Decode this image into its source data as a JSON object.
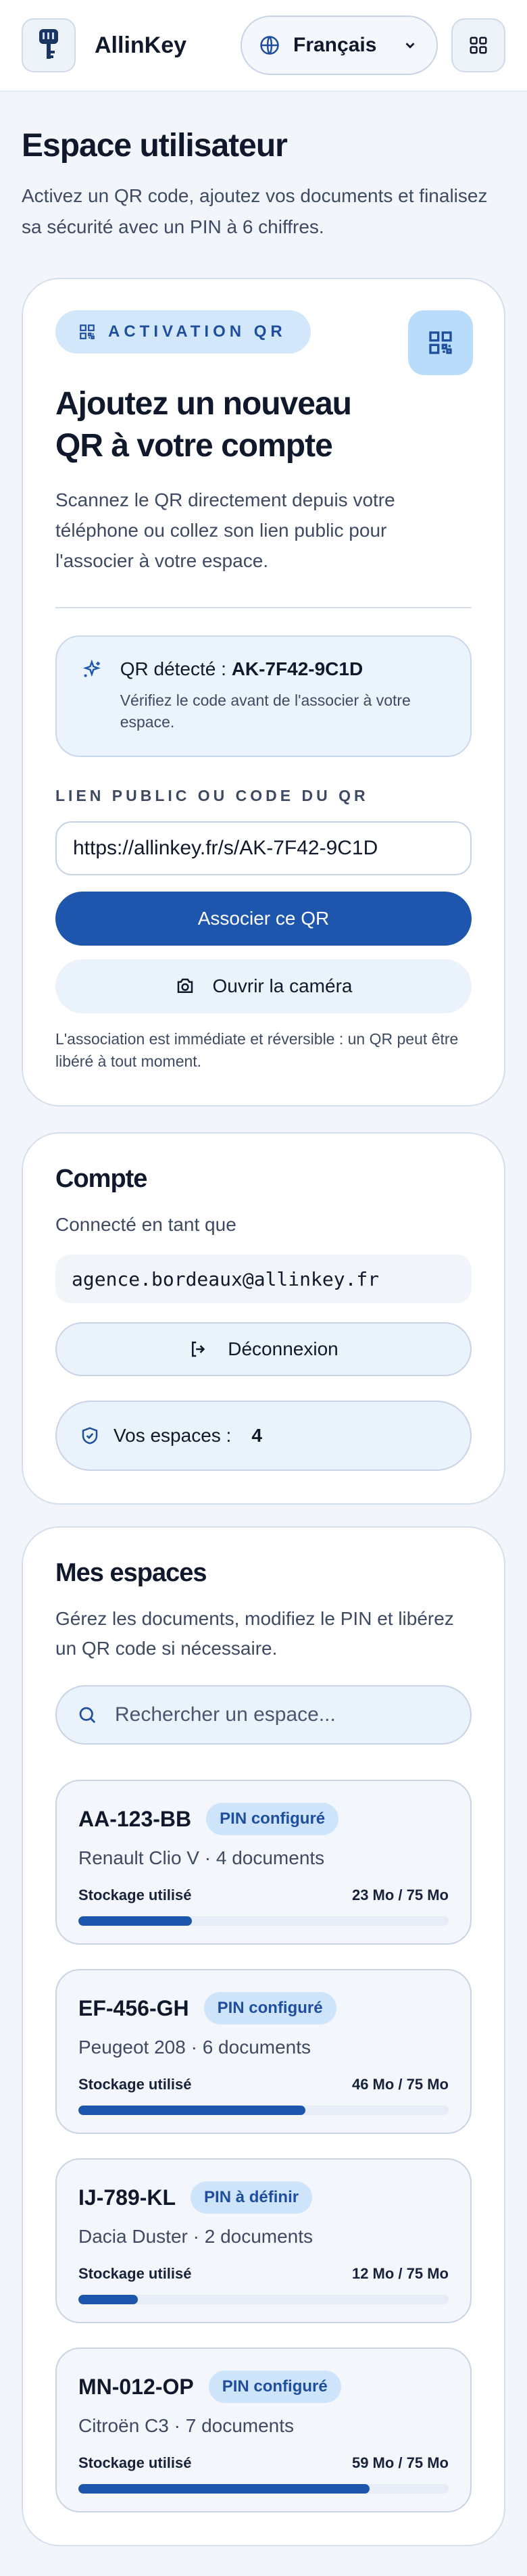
{
  "header": {
    "brand": "AllinKey",
    "language": "Français"
  },
  "page": {
    "title": "Espace utilisateur",
    "subtitle": "Activez un QR code, ajoutez vos documents et finalisez sa sécurité avec un PIN à 6 chiffres."
  },
  "qr_card": {
    "tag": "ACTIVATION QR",
    "title": "Ajoutez un nouveau QR à votre compte",
    "description": "Scannez le QR directement depuis votre téléphone ou collez son lien public pour l'associer à votre espace.",
    "detected_prefix": "QR détecté : ",
    "detected_code": "AK-7F42-9C1D",
    "detected_note": "Vérifiez le code avant de l'associer à votre espace.",
    "field_label": "LIEN PUBLIC OU CODE DU QR",
    "field_value": "https://allinkey.fr/s/AK-7F42-9C1D",
    "associate_button": "Associer ce QR",
    "camera_button": "Ouvrir la caméra",
    "note": "L'association est immédiate et réversible : un QR peut être libéré à tout moment."
  },
  "account": {
    "title": "Compte",
    "connected_label": "Connecté en tant que",
    "email": "agence.bordeaux@allinkey.fr",
    "logout_button": "Déconnexion",
    "spaces_label": "Vos espaces :",
    "spaces_count": "4"
  },
  "spaces": {
    "title": "Mes espaces",
    "subtitle": "Gérez les documents, modifiez le PIN et libérez un QR code si nécessaire.",
    "search_placeholder": "Rechercher un espace...",
    "storage_label": "Stockage utilisé",
    "items": [
      {
        "plate": "AA-123-BB",
        "badge": "PIN configuré",
        "meta": "Renault Clio V · 4 documents",
        "storage": "23 Mo / 75 Mo",
        "used_fraction": 0.307
      },
      {
        "plate": "EF-456-GH",
        "badge": "PIN configuré",
        "meta": "Peugeot 208 · 6 documents",
        "storage": "46 Mo / 75 Mo",
        "used_fraction": 0.613
      },
      {
        "plate": "IJ-789-KL",
        "badge": "PIN à définir",
        "meta": "Dacia Duster · 2 documents",
        "storage": "12 Mo / 75 Mo",
        "used_fraction": 0.16
      },
      {
        "plate": "MN-012-OP",
        "badge": "PIN configuré",
        "meta": "Citroën C3 · 7 documents",
        "storage": "59 Mo / 75 Mo",
        "used_fraction": 0.787
      }
    ]
  },
  "colors": {
    "accent": "#1f56ad",
    "badge_bg": "#cde4fb",
    "page_bg": "#f2f6fb"
  }
}
